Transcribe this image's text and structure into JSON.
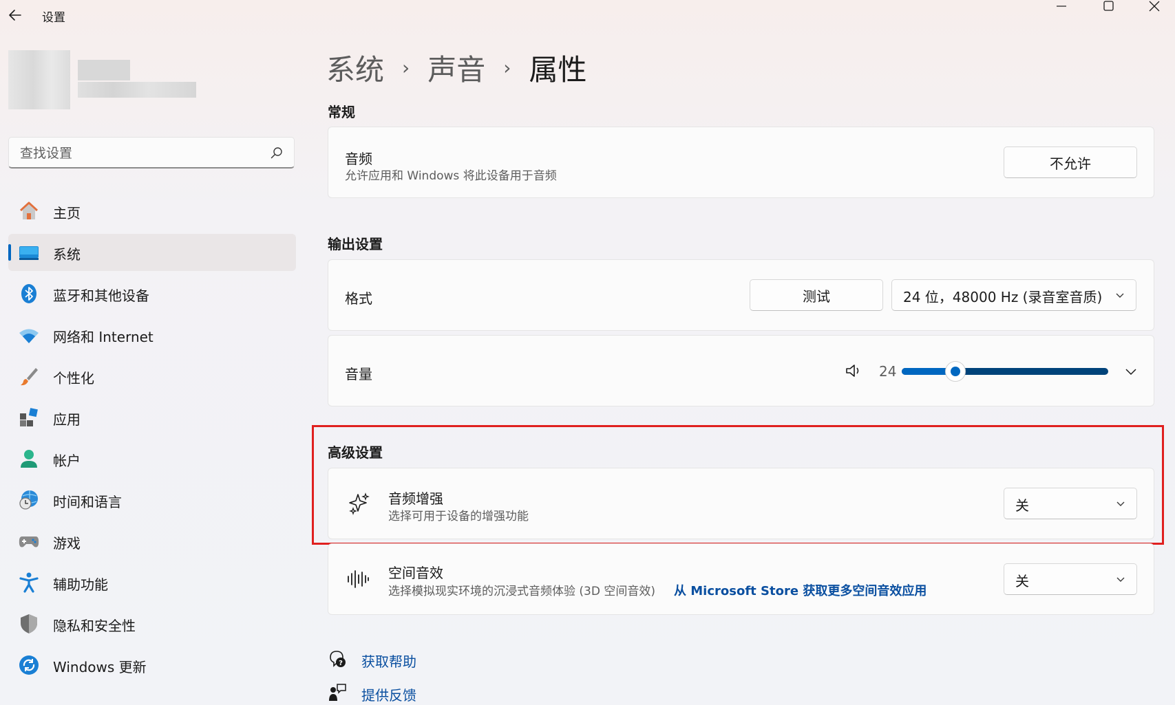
{
  "window": {
    "title": "设置"
  },
  "sidebar": {
    "search_placeholder": "查找设置",
    "items": [
      {
        "label": "主页",
        "icon": "home-icon"
      },
      {
        "label": "系统",
        "icon": "system-display-icon",
        "active": true
      },
      {
        "label": "蓝牙和其他设备",
        "icon": "bluetooth-icon"
      },
      {
        "label": "网络和 Internet",
        "icon": "wifi-icon"
      },
      {
        "label": "个性化",
        "icon": "brush-icon"
      },
      {
        "label": "应用",
        "icon": "apps-icon"
      },
      {
        "label": "帐户",
        "icon": "account-icon"
      },
      {
        "label": "时间和语言",
        "icon": "globe-clock-icon"
      },
      {
        "label": "游戏",
        "icon": "gamepad-icon"
      },
      {
        "label": "辅助功能",
        "icon": "accessibility-icon"
      },
      {
        "label": "隐私和安全性",
        "icon": "shield-icon"
      },
      {
        "label": "Windows 更新",
        "icon": "update-icon"
      }
    ]
  },
  "breadcrumb": [
    "系统",
    "声音",
    "属性"
  ],
  "general": {
    "section_title": "常规",
    "audio": {
      "title": "音频",
      "description": "允许应用和 Windows 将此设备用于音频",
      "button": "不允许"
    }
  },
  "output": {
    "section_title": "输出设置",
    "format": {
      "title": "格式",
      "test_button": "测试",
      "selected": "24 位，48000 Hz (录音室音质)"
    },
    "volume": {
      "title": "音量",
      "value": "24",
      "level": 0.26
    }
  },
  "advanced": {
    "section_title": "高级设置",
    "enhancement": {
      "title": "音频增强",
      "description": "选择可用于设备的增强功能",
      "selected": "关"
    },
    "spatial": {
      "title": "空间音效",
      "description": "选择模拟现实环境的沉浸式音频体验 (3D 空间音效)",
      "link": "从 Microsoft Store 获取更多空间音效应用",
      "selected": "关"
    }
  },
  "footer": {
    "help": "获取帮助",
    "feedback": "提供反馈"
  },
  "colors": {
    "accent": "#0067c0",
    "highlight_box": "#e0201f",
    "link": "#0a4fa0"
  }
}
